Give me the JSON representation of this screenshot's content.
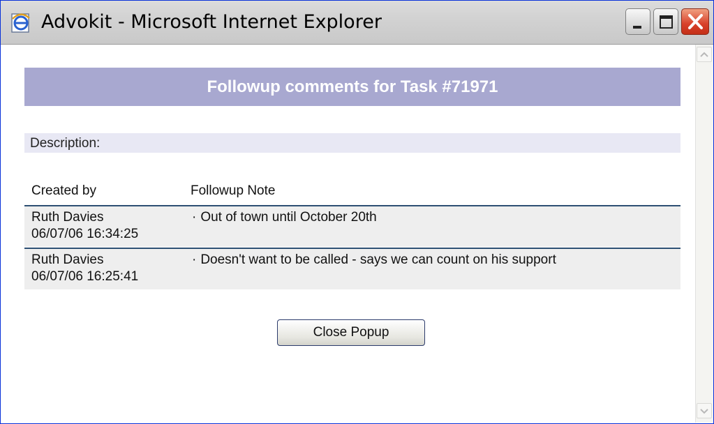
{
  "window": {
    "title": "Advokit - Microsoft Internet Explorer",
    "icon": "ie-icon",
    "controls": [
      "minimize",
      "maximize",
      "close"
    ]
  },
  "page": {
    "heading": "Followup comments for Task #71971",
    "description_label": "Description:",
    "columns": {
      "created_by": "Created by",
      "note": "Followup Note"
    },
    "rows": [
      {
        "name": "Ruth Davies",
        "datetime": "06/07/06  16:34:25",
        "note": "Out of town until October 20th"
      },
      {
        "name": "Ruth Davies",
        "datetime": "06/07/06  16:25:41",
        "note": "Doesn't want to be called - says we can count on his support"
      }
    ],
    "close_button": "Close Popup"
  },
  "colors": {
    "header_bg": "#a8a8d0",
    "description_bg": "#e8e8f4",
    "row_bg": "#eeeeee",
    "row_divider": "#2d4f73"
  }
}
